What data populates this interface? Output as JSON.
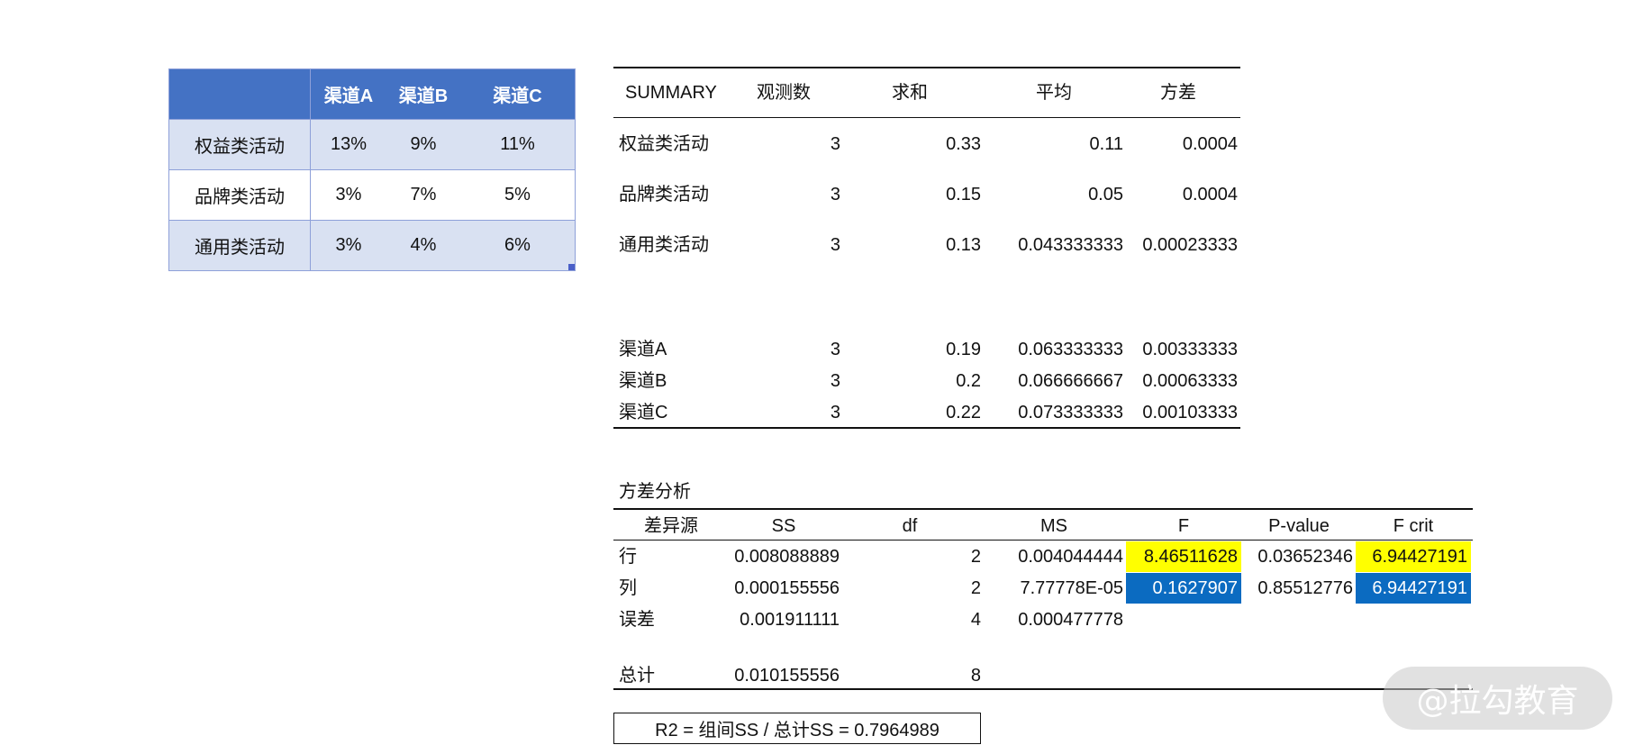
{
  "data_table": {
    "header": [
      "",
      "渠道A",
      "渠道B",
      "渠道C"
    ],
    "rows": [
      [
        "权益类活动",
        "13%",
        "9%",
        "11%"
      ],
      [
        "品牌类活动",
        "3%",
        "7%",
        "5%"
      ],
      [
        "通用类活动",
        "3%",
        "4%",
        "6%"
      ]
    ]
  },
  "summary": {
    "headers": [
      "SUMMARY",
      "观测数",
      "求和",
      "平均",
      "方差"
    ],
    "rows": [
      [
        "权益类活动",
        "3",
        "0.33",
        "0.11",
        "0.0004"
      ],
      [
        "品牌类活动",
        "3",
        "0.15",
        "0.05",
        "0.0004"
      ],
      [
        "通用类活动",
        "3",
        "0.13",
        "0.043333333",
        "0.00023333"
      ],
      [
        "渠道A",
        "3",
        "0.19",
        "0.063333333",
        "0.00333333"
      ],
      [
        "渠道B",
        "3",
        "0.2",
        "0.066666667",
        "0.00063333"
      ],
      [
        "渠道C",
        "3",
        "0.22",
        "0.073333333",
        "0.00103333"
      ]
    ]
  },
  "anova": {
    "title": "方差分析",
    "headers": [
      "差异源",
      "SS",
      "df",
      "MS",
      "F",
      "P-value",
      "F crit"
    ],
    "rows": [
      [
        "行",
        "0.008088889",
        "2",
        "0.004044444",
        "8.46511628",
        "0.03652346",
        "6.94427191"
      ],
      [
        "列",
        "0.000155556",
        "2",
        "7.77778E-05",
        "0.1627907",
        "0.85512776",
        "6.94427191"
      ],
      [
        "误差",
        "0.001911111",
        "4",
        "0.000477778",
        "",
        "",
        ""
      ],
      [
        "总计",
        "0.010155556",
        "8",
        "",
        "",
        "",
        ""
      ]
    ]
  },
  "r2_note": "R2 = 组间SS / 总计SS = 0.7964989",
  "watermark": "@拉勾教育",
  "colors": {
    "header_blue": "#4472c4",
    "band_blue": "#d9e1f2",
    "highlight_yellow": "#ffff00",
    "highlight_blue": "#0b6bc1"
  }
}
